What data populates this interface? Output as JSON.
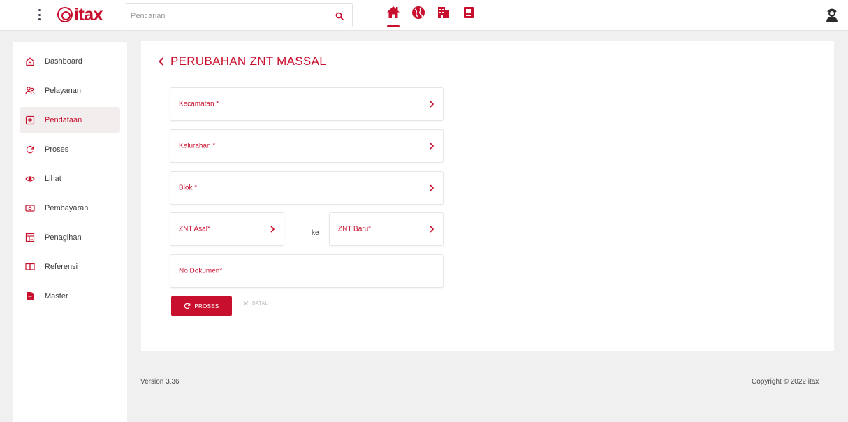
{
  "app": {
    "logo_text": "itax",
    "brand_color": "#c8102e"
  },
  "search": {
    "placeholder": "Pencarian",
    "icon": "search-icon"
  },
  "topnav": [
    {
      "icon": "home-icon",
      "active": true
    },
    {
      "icon": "globe-icon",
      "active": false
    },
    {
      "icon": "building-icon",
      "active": false
    },
    {
      "icon": "document-icon",
      "active": false
    }
  ],
  "user": {
    "icon": "user-avatar-icon"
  },
  "sidebar": {
    "items": [
      {
        "label": "Dashboard",
        "icon": "home-outline-icon",
        "active": false
      },
      {
        "label": "Pelayanan",
        "icon": "users-icon",
        "active": false
      },
      {
        "label": "Pendataan",
        "icon": "plus-square-icon",
        "active": true
      },
      {
        "label": "Proses",
        "icon": "refresh-icon",
        "active": false
      },
      {
        "label": "Lihat",
        "icon": "eye-icon",
        "active": false
      },
      {
        "label": "Pembayaran",
        "icon": "money-icon",
        "active": false
      },
      {
        "label": "Penagihan",
        "icon": "invoice-icon",
        "active": false
      },
      {
        "label": "Referensi",
        "icon": "book-icon",
        "active": false
      },
      {
        "label": "Master",
        "icon": "file-icon",
        "active": false
      }
    ]
  },
  "main": {
    "title": "PERUBAHAN ZNT MASSAL",
    "fields": {
      "kecamatan": "Kecamatan *",
      "kelurahan": "Kelurahan *",
      "blok": "Blok *",
      "znt_asal": "ZNT Asal*",
      "ke": "ke",
      "znt_baru": "ZNT Baru*",
      "no_dokumen": "No Dokumen*"
    },
    "buttons": {
      "proses": "PROSES",
      "batal": "BATAL"
    }
  },
  "footer": {
    "version": "Version 3.36",
    "copyright": "Copyright © 2022 itax"
  }
}
